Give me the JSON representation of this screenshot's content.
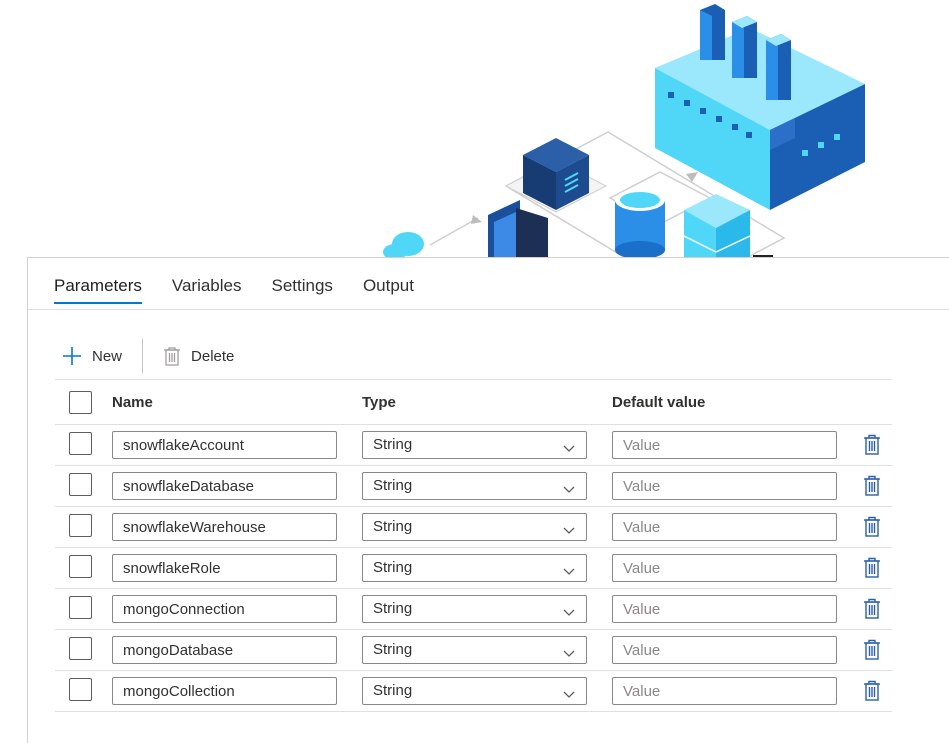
{
  "tabs": [
    {
      "label": "Parameters",
      "active": true
    },
    {
      "label": "Variables",
      "active": false
    },
    {
      "label": "Settings",
      "active": false
    },
    {
      "label": "Output",
      "active": false
    }
  ],
  "toolbar": {
    "new_label": "New",
    "delete_label": "Delete"
  },
  "table": {
    "headers": {
      "name": "Name",
      "type": "Type",
      "default": "Default value"
    },
    "value_placeholder": "Value",
    "rows": [
      {
        "name": "snowflakeAccount",
        "type": "String"
      },
      {
        "name": "snowflakeDatabase",
        "type": "String"
      },
      {
        "name": "snowflakeWarehouse",
        "type": "String"
      },
      {
        "name": "snowflakeRole",
        "type": "String"
      },
      {
        "name": "mongoConnection",
        "type": "String"
      },
      {
        "name": "mongoDatabase",
        "type": "String"
      },
      {
        "name": "mongoCollection",
        "type": "String"
      }
    ]
  },
  "colors": {
    "accent": "#0078d4",
    "delete_icon": "#2b5fa8",
    "factory_light": "#50d7f7",
    "factory_dark": "#1a5fb4"
  },
  "icons": {
    "add": "plus-icon",
    "toolbar_delete": "trash-icon",
    "row_delete": "trash-icon",
    "dropdown": "chevron-down-icon"
  }
}
